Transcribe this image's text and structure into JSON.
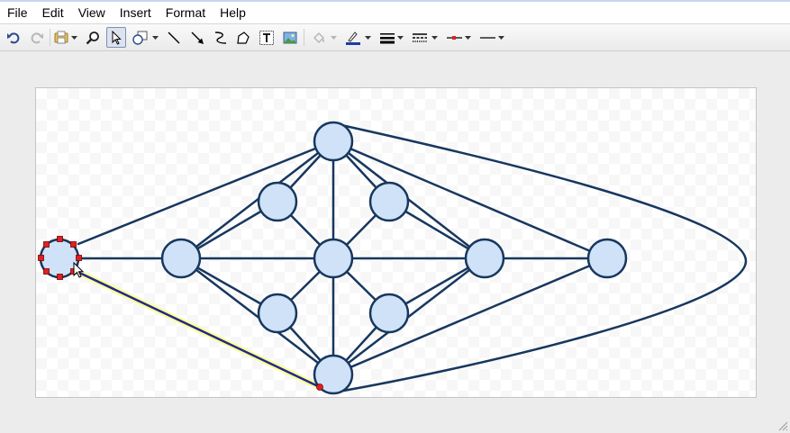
{
  "menu": [
    "File",
    "Edit",
    "View",
    "Insert",
    "Format",
    "Help"
  ],
  "toolbar": {
    "icons": [
      "undo-icon",
      "redo-icon",
      "arrange-icon",
      "zoom-icon",
      "select-icon",
      "shape-icon",
      "line-icon",
      "arrow-icon",
      "elbow-connector-icon",
      "polygon-icon",
      "text-icon",
      "image-icon",
      "fill-color-icon",
      "line-color-icon",
      "line-weight-icon",
      "line-dash-icon",
      "arrowhead-start-icon",
      "arrowhead-end-icon"
    ],
    "active_tool": "select-icon",
    "line_color": "#1f3aa8"
  },
  "colors": {
    "node_fill": "#cfe2f7",
    "node_stroke": "#17375e",
    "edge": "#17375e",
    "selected_line": "#1f2a8c",
    "selection_halo": "#ffff99",
    "handle": "#e02020"
  }
}
